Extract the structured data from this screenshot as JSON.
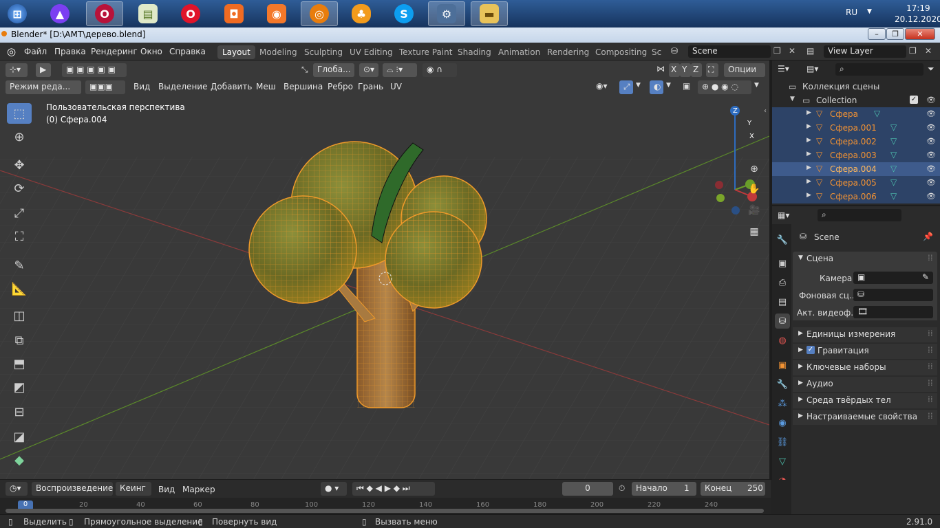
{
  "taskbar": {
    "items": [
      "start",
      "alice",
      "opera-gx",
      "notes",
      "opera",
      "screenshot",
      "camera",
      "blender",
      "fl-studio",
      "skype",
      "gear",
      "explorer"
    ],
    "language": "RU",
    "time": "17:19",
    "date": "20.12.2020"
  },
  "window": {
    "title": "Blender* [D:\\AMT\\дерево.blend]"
  },
  "menu": {
    "items": [
      "Файл",
      "Правка",
      "Рендеринг",
      "Окно",
      "Справка"
    ]
  },
  "workspaces": [
    "Layout",
    "Modeling",
    "Sculpting",
    "UV Editing",
    "Texture Paint",
    "Shading",
    "Animation",
    "Rendering",
    "Compositing",
    "Sci"
  ],
  "scene": {
    "name": "Scene",
    "view_layer": "View Layer"
  },
  "viewport": {
    "orientation": "Глоба...",
    "options": "Опции",
    "mode": "Режим реда...",
    "menus": [
      "Вид",
      "Выделение",
      "Добавить",
      "Меш",
      "Вершина",
      "Ребро",
      "Грань",
      "UV"
    ],
    "perspective_label": "Пользовательская перспектива",
    "object_label": "(0) Сфера.004",
    "gizmo": {
      "x": "X",
      "y": "Y",
      "z": "Z"
    },
    "axis_buttons": [
      "X",
      "Y",
      "Z"
    ]
  },
  "outliner": {
    "root": "Коллекция сцены",
    "collection": "Collection",
    "objects": [
      "Сфера",
      "Сфера.001",
      "Сфера.002",
      "Сфера.003",
      "Сфера.004",
      "Сфера.005",
      "Сфера.006"
    ],
    "active": "Сфера.004"
  },
  "properties": {
    "context": "Scene",
    "panel_title": "Сцена",
    "camera_label": "Камера",
    "background_label": "Фоновая сц...",
    "clip_label": "Акт. видеоф...",
    "sections": [
      "Единицы измерения",
      "Гравитация",
      "Ключевые наборы",
      "Аудио",
      "Среда твёрдых тел",
      "Настраиваемые свойства"
    ],
    "gravity_checked": true
  },
  "timeline": {
    "menus": [
      "Воспроизведение",
      "Кеинг",
      "Вид",
      "Маркер"
    ],
    "current_frame": "0",
    "start_label": "Начало",
    "start": "1",
    "end_label": "Конец",
    "end": "250",
    "ruler": [
      "0",
      "20",
      "40",
      "60",
      "80",
      "100",
      "120",
      "140",
      "160",
      "180",
      "200",
      "220",
      "240"
    ]
  },
  "status": {
    "select": "Выделить",
    "box_select": "Прямоугольное выделение",
    "rotate": "Повернуть вид",
    "menu": "Вызвать меню",
    "version": "2.91.0"
  },
  "colors": {
    "accent": "#5680c2",
    "selected": "#f29233",
    "bg": "#393939"
  }
}
